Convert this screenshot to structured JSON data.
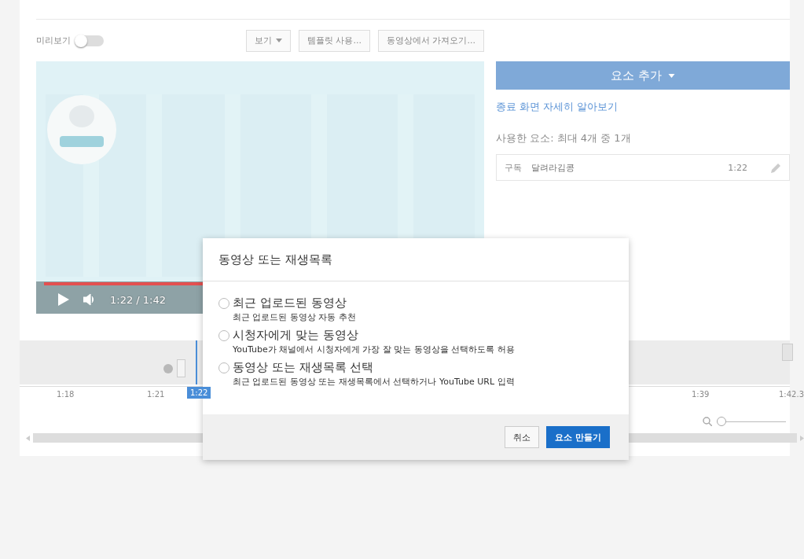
{
  "toolbar": {
    "preview_label": "미리보기",
    "preview_on": false,
    "buttons": [
      {
        "label": "보기",
        "dropdown": true
      },
      {
        "label": "템플릿 사용...",
        "dropdown": false
      },
      {
        "label": "동영상에서 가져오기...",
        "dropdown": false
      }
    ]
  },
  "player": {
    "time": "1:22 / 1:42",
    "level": 0.8
  },
  "side": {
    "add_button": "요소 추가",
    "learn_link": "종료 화면 자세히 알아보기",
    "usage": "사용한 요소: 최대 4개 중 1개",
    "elements": [
      {
        "type": "구독",
        "name": "달려라김콩",
        "time": "1:22"
      }
    ]
  },
  "timeline": {
    "ticks": [
      "1:18",
      "1:21",
      "1:39",
      "1:42.3"
    ],
    "playhead": "1:22",
    "zoom": {
      "level": 0
    }
  },
  "dialog": {
    "title": "동영상 또는 재생목록",
    "options": [
      {
        "label": "최근 업로드된 동영상",
        "description": "최근 업로드된 동영상 자동 추천",
        "selected": false
      },
      {
        "label": "시청자에게 맞는 동영상",
        "description": "YouTube가 채널에서 시청자에게 가장 잘 맞는 동영상을 선택하도록 허용",
        "selected": false
      },
      {
        "label": "동영상 또는 재생목록 선택",
        "description": "최근 업로드된 동영상 또는 재생목록에서 선택하거나 YouTube URL 입력",
        "selected": false
      }
    ],
    "cancel": "취소",
    "confirm": "요소 만들기"
  }
}
